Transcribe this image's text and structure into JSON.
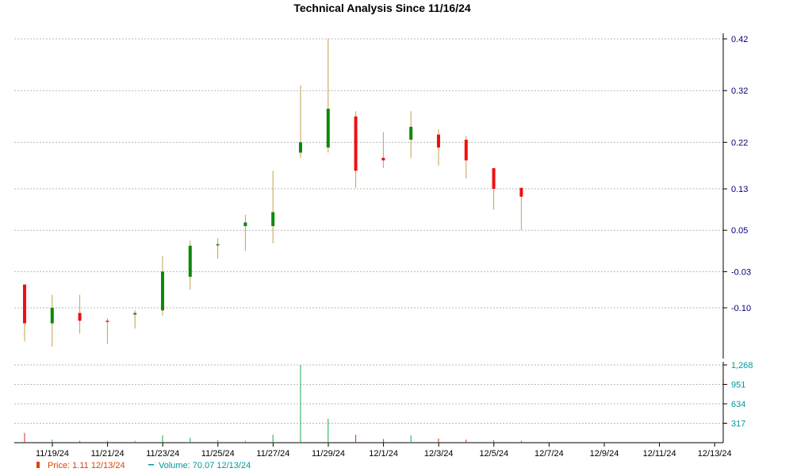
{
  "chart_data": {
    "type": "candlestick",
    "title": "Technical Analysis Since 11/16/24",
    "price_axis": {
      "ticks": [
        "0.42",
        "0.32",
        "0.22",
        "0.13",
        "0.05",
        "-0.03",
        "-0.10"
      ],
      "ylim": [
        -0.21,
        0.425
      ]
    },
    "volume_axis": {
      "ticks": [
        "1,268",
        "951",
        "634",
        "317"
      ],
      "ylim": [
        0,
        1268
      ]
    },
    "x_ticks": [
      "11/19/24",
      "11/21/24",
      "11/23/24",
      "11/25/24",
      "11/27/24",
      "11/29/24",
      "12/1/24",
      "12/3/24",
      "12/5/24",
      "12/7/24",
      "12/9/24",
      "12/11/24",
      "12/13/24"
    ],
    "candles": [
      {
        "date": "11/18/24",
        "open": -0.055,
        "high": -0.055,
        "low": -0.165,
        "close": -0.13,
        "volume": 160
      },
      {
        "date": "11/19/24",
        "open": -0.13,
        "high": -0.075,
        "low": -0.175,
        "close": -0.1,
        "volume": 50
      },
      {
        "date": "11/20/24",
        "open": -0.11,
        "high": -0.075,
        "low": -0.15,
        "close": -0.125,
        "volume": 30
      },
      {
        "date": "11/21/24",
        "open": -0.125,
        "high": -0.12,
        "low": -0.17,
        "close": -0.127,
        "volume": 30
      },
      {
        "date": "11/22/24",
        "open": -0.113,
        "high": -0.105,
        "low": -0.14,
        "close": -0.11,
        "volume": 30
      },
      {
        "date": "11/25/24",
        "open": -0.105,
        "high": 0.0,
        "low": -0.115,
        "close": -0.03,
        "volume": 120
      },
      {
        "date": "11/26/24",
        "open": -0.04,
        "high": 0.03,
        "low": -0.065,
        "close": 0.02,
        "volume": 80
      },
      {
        "date": "11/27/24",
        "open": 0.022,
        "high": 0.035,
        "low": -0.005,
        "close": 0.023,
        "volume": 40
      },
      {
        "date": "11/29/24",
        "open": 0.058,
        "high": 0.08,
        "low": 0.01,
        "close": 0.065,
        "volume": 30
      },
      {
        "date": "12/2/24",
        "open": 0.058,
        "high": 0.165,
        "low": 0.025,
        "close": 0.085,
        "volume": 130
      },
      {
        "date": "12/3/24",
        "open": 0.2,
        "high": 0.33,
        "low": 0.19,
        "close": 0.22,
        "volume": 1268
      },
      {
        "date": "12/4/24",
        "open": 0.21,
        "high": 0.42,
        "low": 0.2,
        "close": 0.285,
        "volume": 390
      },
      {
        "date": "12/5/24",
        "open": 0.27,
        "high": 0.28,
        "low": 0.132,
        "close": 0.165,
        "volume": 130
      },
      {
        "date": "12/6/24",
        "open": 0.19,
        "high": 0.24,
        "low": 0.17,
        "close": 0.185,
        "volume": 60
      },
      {
        "date": "12/9/24",
        "open": 0.225,
        "high": 0.28,
        "low": 0.19,
        "close": 0.25,
        "volume": 120
      },
      {
        "date": "12/10/24",
        "open": 0.235,
        "high": 0.245,
        "low": 0.175,
        "close": 0.21,
        "volume": 70
      },
      {
        "date": "12/11/24",
        "open": 0.225,
        "high": 0.232,
        "low": 0.15,
        "close": 0.185,
        "volume": 50
      },
      {
        "date": "12/12/24",
        "open": 0.17,
        "high": 0.17,
        "low": 0.09,
        "close": 0.13,
        "volume": 40
      },
      {
        "date": "12/13/24",
        "open": 0.132,
        "high": 0.132,
        "low": 0.05,
        "close": 0.115,
        "volume": 30
      }
    ],
    "legend": {
      "price": "Price: 1.11  12/13/24",
      "volume": "Volume: 70.07  12/13/24",
      "placement": "bottom-left"
    },
    "grid": true
  },
  "colors": {
    "up": "#0a8a0a",
    "down": "#ee1111",
    "wick": "#c8a050",
    "price_axis_text": "#00007a",
    "volume_axis_text": "#009999",
    "vol_up": "#1aaa44",
    "vol_down": "#cc3311",
    "legend_price": "#dd4400",
    "legend_volume": "#009999"
  }
}
